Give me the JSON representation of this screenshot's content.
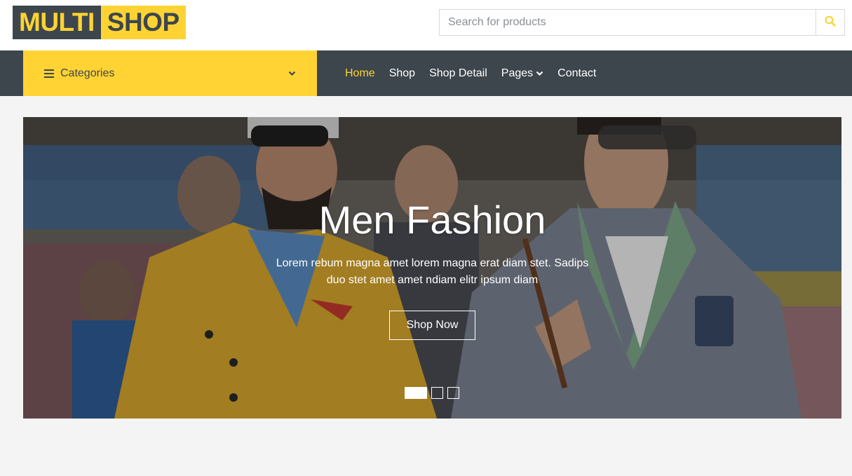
{
  "brand": {
    "part1": "MULTI",
    "part2": "SHOP"
  },
  "search": {
    "placeholder": "Search for products",
    "value": "",
    "icon": "search-icon"
  },
  "categories": {
    "label": "Categories",
    "icon": "bars-icon",
    "chevron": "chevron-down-icon"
  },
  "nav": {
    "items": [
      {
        "label": "Home",
        "active": true
      },
      {
        "label": "Shop",
        "active": false
      },
      {
        "label": "Shop Detail",
        "active": false
      },
      {
        "label": "Pages",
        "active": false,
        "dropdown": true
      },
      {
        "label": "Contact",
        "active": false
      }
    ]
  },
  "hero": {
    "title": "Men Fashion",
    "text": "Lorem rebum magna amet lorem magna erat diam stet. Sadips duo stet amet amet ndiam elitr ipsum diam",
    "button": "Shop Now",
    "slides_count": 3,
    "active_slide": 1
  },
  "colors": {
    "accent": "#ffd333",
    "dark": "#3d464d",
    "background": "#f4f4f4"
  }
}
